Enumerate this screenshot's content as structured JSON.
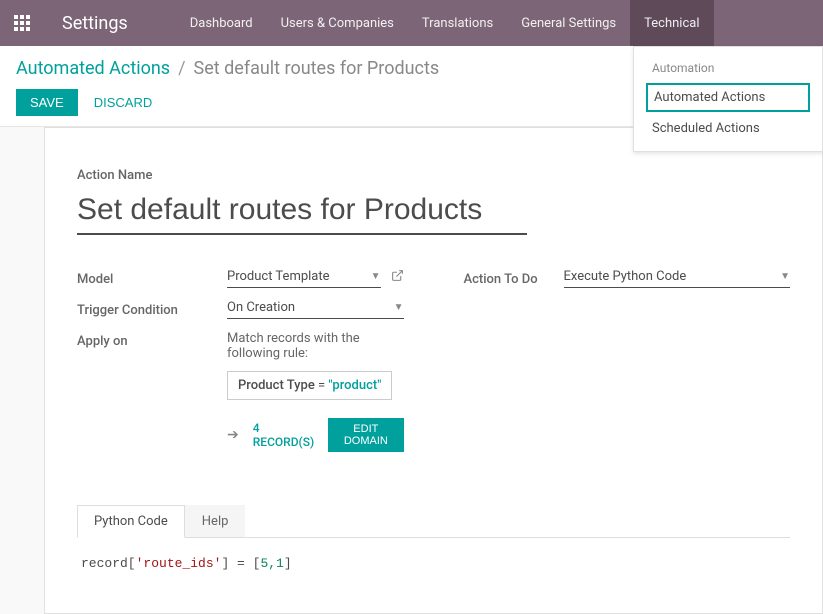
{
  "nav": {
    "app_title": "Settings",
    "items": [
      "Dashboard",
      "Users & Companies",
      "Translations",
      "General Settings",
      "Technical"
    ],
    "active_index": 4
  },
  "dropdown": {
    "header": "Automation",
    "items": [
      "Automated Actions",
      "Scheduled Actions"
    ],
    "active_index": 0
  },
  "breadcrumb": {
    "link": "Automated Actions",
    "current": "Set default routes for Products"
  },
  "buttons": {
    "save": "SAVE",
    "discard": "DISCARD"
  },
  "form": {
    "action_name_label": "Action Name",
    "action_name_value": "Set default routes for Products",
    "labels": {
      "model": "Model",
      "trigger": "Trigger Condition",
      "apply_on": "Apply on",
      "action_to_do": "Action To Do"
    },
    "model_value": "Product Template",
    "trigger_value": "On Creation",
    "match_text": "Match records with the following rule:",
    "domain": {
      "field": "Product Type",
      "op": " = ",
      "value": "\"product\""
    },
    "records_count": "4 RECORD(S)",
    "edit_domain": "EDIT DOMAIN",
    "action_to_do_value": "Execute Python Code"
  },
  "tabs": {
    "items": [
      "Python Code",
      "Help"
    ],
    "active_index": 0
  },
  "code": {
    "prefix": "record[",
    "key": "'route_ids'",
    "mid": "] = [",
    "val": "5,1",
    "suffix": "]"
  }
}
